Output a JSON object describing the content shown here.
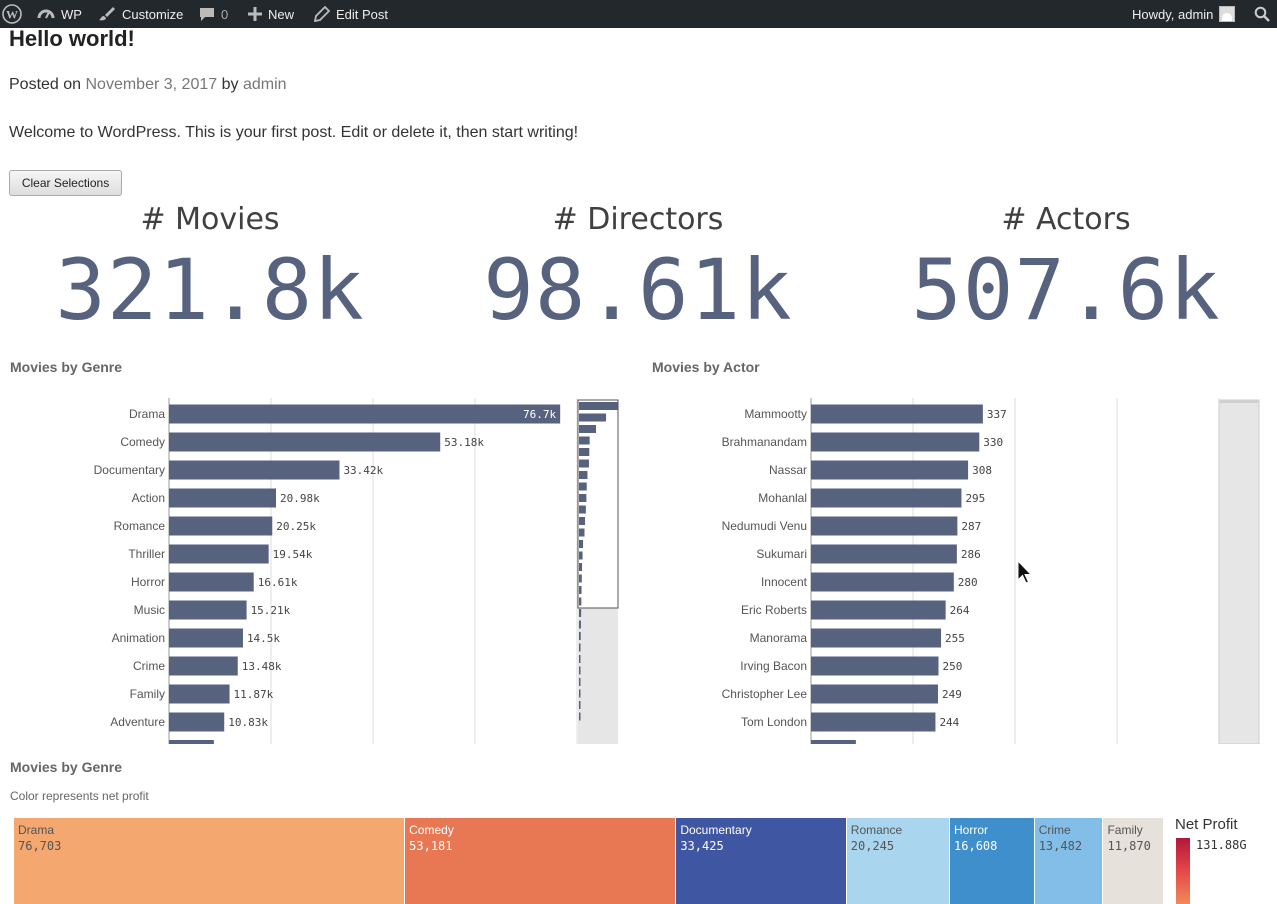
{
  "adminbar": {
    "site_name": "WP",
    "customize": "Customize",
    "comments_count": "0",
    "new_label": "New",
    "edit_post": "Edit Post",
    "howdy": "Howdy, admin"
  },
  "post": {
    "title": "Hello world!",
    "posted_on": "Posted on ",
    "date": "November 3, 2017",
    "by": " by ",
    "author": "admin",
    "body": "Welcome to WordPress. This is your first post. Edit or delete it, then start writing!",
    "clear_button": "Clear Selections"
  },
  "kpis": [
    {
      "title": "# Movies",
      "value": "321.8k"
    },
    {
      "title": "# Directors",
      "value": "98.61k"
    },
    {
      "title": "# Actors",
      "value": "507.6k"
    }
  ],
  "chart_data": [
    {
      "type": "bar",
      "title": "Movies by Genre",
      "orientation": "horizontal",
      "categories": [
        "Drama",
        "Comedy",
        "Documentary",
        "Action",
        "Romance",
        "Thriller",
        "Horror",
        "Music",
        "Animation",
        "Crime",
        "Family",
        "Adventure"
      ],
      "values": [
        76700,
        53180,
        33420,
        20980,
        20250,
        19540,
        16610,
        15210,
        14500,
        13480,
        11870,
        10830
      ],
      "value_labels": [
        "76.7k",
        "53.18k",
        "33.42k",
        "20.98k",
        "20.25k",
        "19.54k",
        "16.61k",
        "15.21k",
        "14.5k",
        "13.48k",
        "11.87k",
        "10.83k"
      ],
      "xlim": [
        0,
        80000
      ],
      "grid": true,
      "bar_color": "#56627e",
      "minimap": true
    },
    {
      "type": "bar",
      "title": "Movies by Actor",
      "orientation": "horizontal",
      "categories": [
        "Mammootty",
        "Brahmanandam",
        "Nassar",
        "Mohanlal",
        "Nedumudi Venu",
        "Sukumari",
        "Innocent",
        "Eric Roberts",
        "Manorama",
        "Irving Bacon",
        "Christopher Lee",
        "Tom London"
      ],
      "values": [
        337,
        330,
        308,
        295,
        287,
        286,
        280,
        264,
        255,
        250,
        249,
        244
      ],
      "value_labels": [
        "337",
        "330",
        "308",
        "295",
        "287",
        "286",
        "280",
        "264",
        "255",
        "250",
        "249",
        "244"
      ],
      "xlim": [
        0,
        800
      ],
      "grid": true,
      "bar_color": "#56627e"
    },
    {
      "type": "treemap",
      "title": "Movies by Genre",
      "subtitle": "Color represents net profit",
      "categories": [
        "Drama",
        "Comedy",
        "Documentary",
        "Romance",
        "Horror",
        "Crime",
        "Family"
      ],
      "values": [
        76703,
        53181,
        33425,
        20245,
        16608,
        13482,
        11870
      ],
      "value_labels": [
        "76,703",
        "53,181",
        "33,425",
        "20,245",
        "16,608",
        "13,482",
        "11,870"
      ],
      "colors": [
        "#f4a76f",
        "#e77853",
        "#3f56a3",
        "#aad5ef",
        "#3f8fcd",
        "#82bee8",
        "#e6e1da"
      ],
      "text_colors": [
        "#555555",
        "#ffffff",
        "#ffffff",
        "#555555",
        "#ffffff",
        "#555555",
        "#555555"
      ],
      "legend_title": "Net Profit",
      "legend_max": "131.88G"
    }
  ]
}
